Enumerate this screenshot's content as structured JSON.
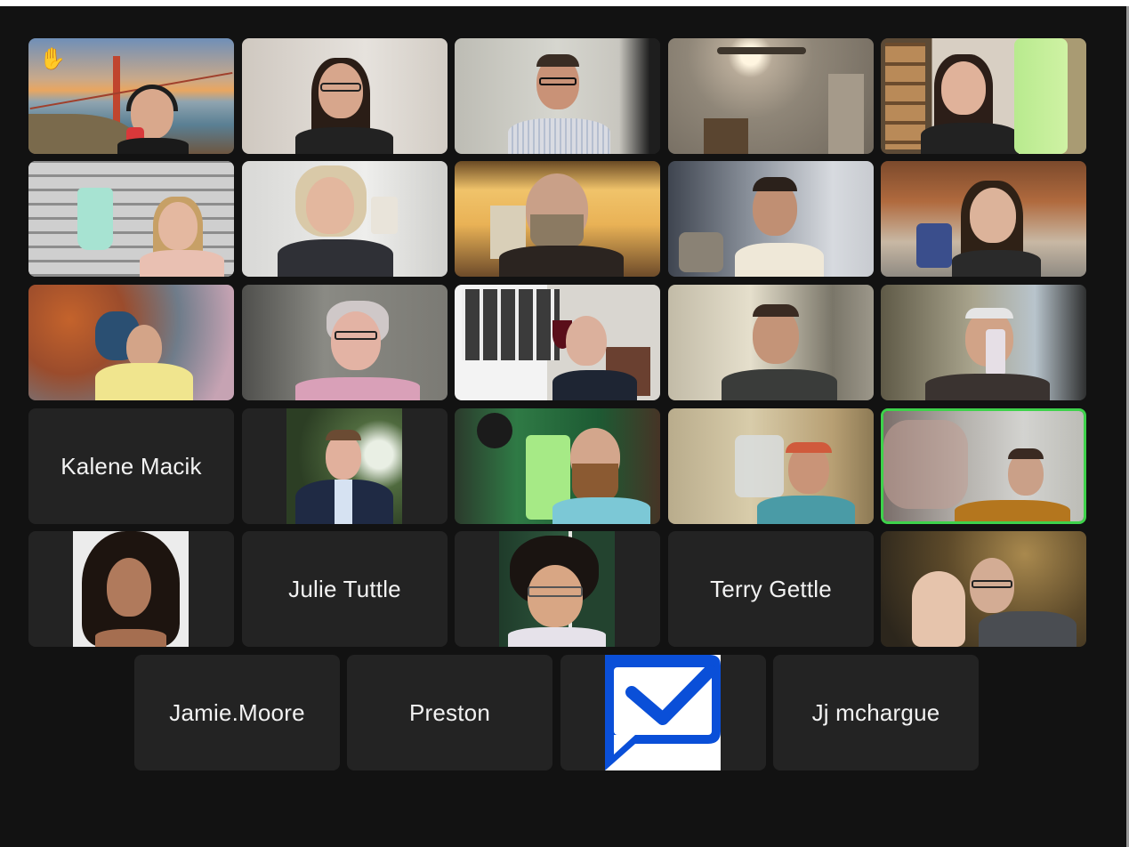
{
  "meeting": {
    "view": "gallery",
    "active_speaker_color": "#3ed24b",
    "background_color": "#121212",
    "tile_color": "#232323"
  },
  "participants": [
    {
      "id": 1,
      "type": "video",
      "scene": "golden-gate-bridge-background",
      "reaction": "✋",
      "reaction_name": "raised-hand"
    },
    {
      "id": 2,
      "type": "video",
      "scene": "woman-glasses-white-wall"
    },
    {
      "id": 3,
      "type": "video",
      "scene": "man-glasses-striped-shirt"
    },
    {
      "id": 4,
      "type": "video",
      "scene": "empty-room-ceiling-fan"
    },
    {
      "id": 5,
      "type": "video",
      "scene": "woman-bookshelf-green-cup"
    },
    {
      "id": 6,
      "type": "video",
      "scene": "woman-brick-wall-teal-tumbler"
    },
    {
      "id": 7,
      "type": "video",
      "scene": "blonde-woman-glasses-mug"
    },
    {
      "id": 8,
      "type": "video",
      "scene": "bearded-man-string-lights"
    },
    {
      "id": 9,
      "type": "video",
      "scene": "man-mug-office"
    },
    {
      "id": 10,
      "type": "video",
      "scene": "woman-headset-blue-cup"
    },
    {
      "id": 11,
      "type": "video",
      "scene": "man-nebula-background-cup"
    },
    {
      "id": 12,
      "type": "video",
      "scene": "woman-glasses-pink-top"
    },
    {
      "id": 13,
      "type": "video",
      "scene": "man-red-wine-glass"
    },
    {
      "id": 14,
      "type": "video",
      "scene": "man-henley-living-room"
    },
    {
      "id": 15,
      "type": "video",
      "scene": "older-man-glass"
    },
    {
      "id": 16,
      "type": "name",
      "name": "Kalene Macik"
    },
    {
      "id": 17,
      "type": "profile-photo",
      "scene": "man-suit-foliage"
    },
    {
      "id": 18,
      "type": "video",
      "scene": "bearded-man-headphones-green-cup"
    },
    {
      "id": 19,
      "type": "video",
      "scene": "man-cap-toast-glass"
    },
    {
      "id": 20,
      "type": "video",
      "scene": "man-hawaiian-shirt-glass",
      "active_speaker": true
    },
    {
      "id": 21,
      "type": "profile-photo",
      "scene": "woman-curly-hair"
    },
    {
      "id": 22,
      "type": "name",
      "name": "Julie Tuttle"
    },
    {
      "id": 23,
      "type": "profile-photo",
      "scene": "young-man-glasses-window"
    },
    {
      "id": 24,
      "type": "name",
      "name": "Terry Gettle"
    },
    {
      "id": 25,
      "type": "video",
      "scene": "man-glasses-hand-ring"
    },
    {
      "id": 26,
      "type": "name",
      "name": "Jamie.Moore"
    },
    {
      "id": 27,
      "type": "name",
      "name": "Preston"
    },
    {
      "id": 28,
      "type": "profile-photo",
      "scene": "mail-app-logo",
      "icon": "mail-message-icon",
      "logo_color": "#0a4fd8"
    },
    {
      "id": 29,
      "type": "name",
      "name": "Jj mchargue"
    }
  ]
}
